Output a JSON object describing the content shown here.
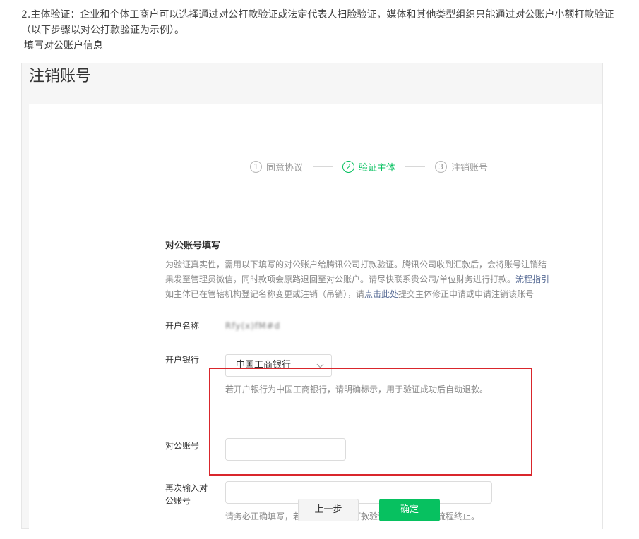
{
  "intro": {
    "line1": "2.主体验证：企业和个体工商户可以选择通过对公打款验证或法定代表人扫脸验证，媒体和其他类型组织只能通过对公账户小额打款验证（以下步骤以对公打款验证为示例）。",
    "line2": "填写对公账户信息"
  },
  "panel": {
    "title": "注销账号"
  },
  "steps": [
    {
      "num": "1",
      "label": "同意协议"
    },
    {
      "num": "2",
      "label": "验证主体"
    },
    {
      "num": "3",
      "label": "注销账号"
    }
  ],
  "section": {
    "title": "对公账号填写",
    "desc_line1": "为验证真实性，需用以下填写的对公账户给腾讯公司打款验证。腾讯公司收到汇款后，会将账号注销结",
    "desc_line2_pre": "果发至管理员微信，同时款项会原路退回至对公账户。请尽快联系贵公司/单位财务进行打款。",
    "desc_link1": "流程指引",
    "desc_line3_pre": "如主体已在管辖机构登记名称变更或注销（吊销），请",
    "desc_link2": "点击此处",
    "desc_line3_post": "提交主体修正申请或申请注销该账号"
  },
  "form": {
    "account_name_label": "开户名称",
    "account_name_value": "Rfy(x)fM#d",
    "bank_label": "开户银行",
    "bank_value": "中国工商银行",
    "bank_hint": "若开户银行为中国工商银行，请明确标示，用于验证成功后自动退款。",
    "account_no_label": "对公账号",
    "account_no_value": "",
    "reenter_label_1": "再次输入对",
    "reenter_label_2": "公账号",
    "reenter_value": "",
    "reenter_hint": "请务必正确填写，若填写错误造成打款验证失败，会导致流程终止。"
  },
  "buttons": {
    "prev": "上一步",
    "confirm": "确定"
  },
  "colors": {
    "accent": "#07c160",
    "highlight": "#d9262c",
    "link": "#576b95"
  }
}
